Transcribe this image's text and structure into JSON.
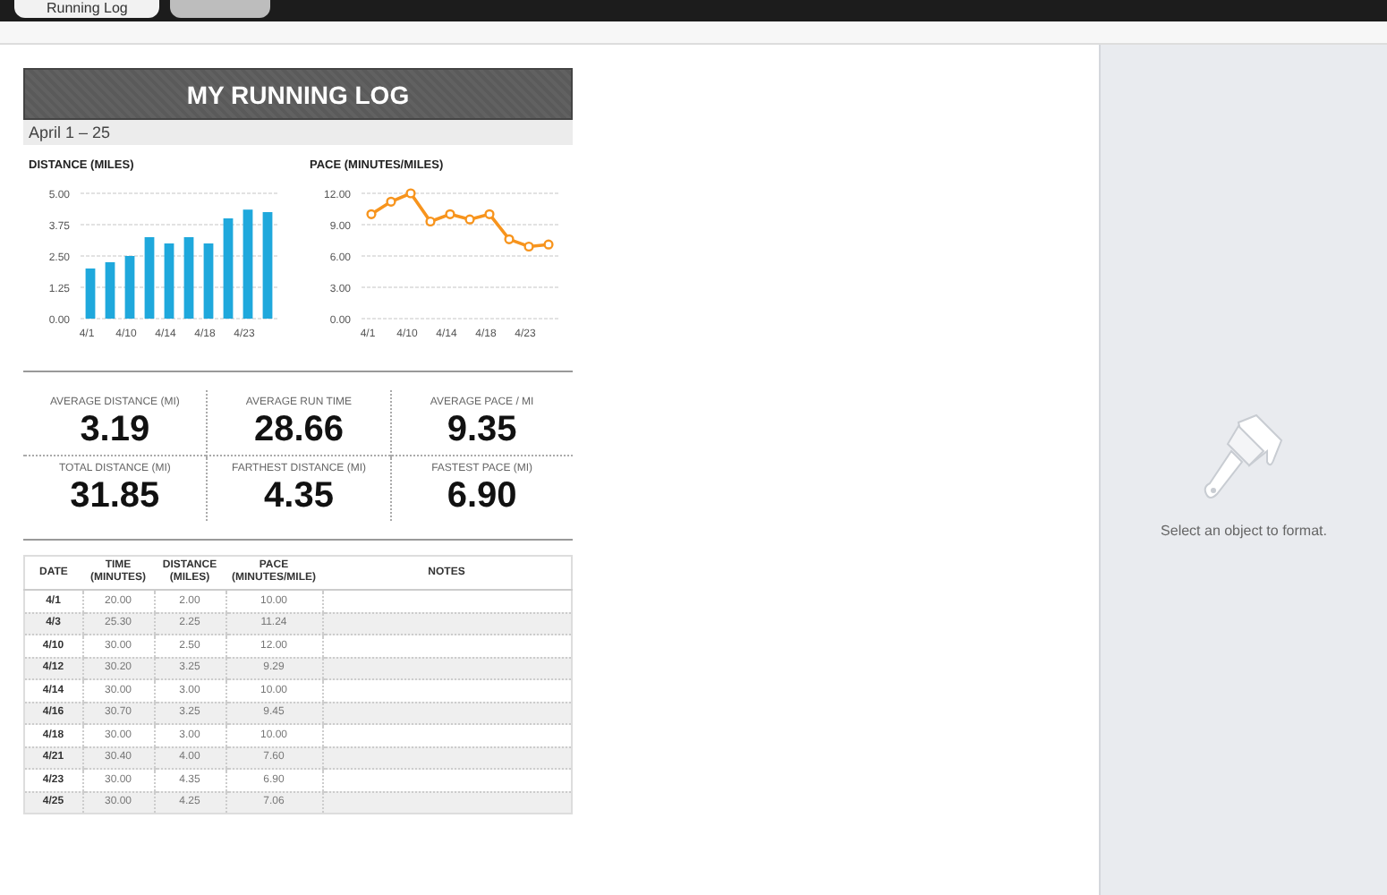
{
  "tabs": [
    {
      "label": "Running Log",
      "selected": true
    },
    {
      "selected": false
    }
  ],
  "title": "MY RUNNING LOG",
  "date_range": "April 1 – 25",
  "distance_chart": {
    "title": "DISTANCE (MILES)",
    "chart_data": {
      "type": "bar",
      "grid": true,
      "categories": [
        "4/1",
        null,
        "4/10",
        null,
        "4/14",
        null,
        "4/18",
        null,
        "4/23",
        null
      ],
      "series": [
        {
          "color": "#1fa8dc",
          "values": [
            2.0,
            2.25,
            2.5,
            3.25,
            3.0,
            3.25,
            3.0,
            4.0,
            4.35,
            4.25
          ]
        }
      ],
      "ylim": [
        0,
        5
      ],
      "yticks": [
        {
          "value": 0,
          "label": "0.00"
        },
        {
          "value": 1.25,
          "label": "1.25"
        },
        {
          "value": 2.5,
          "label": "2.50"
        },
        {
          "value": 3.75,
          "label": "3.75"
        },
        {
          "value": 5,
          "label": "5.00"
        }
      ]
    }
  },
  "pace_chart": {
    "title": "PACE (MINUTES/MILES)",
    "chart_data": {
      "type": "line",
      "grid": true,
      "categories": [
        "4/1",
        null,
        "4/10",
        null,
        "4/14",
        null,
        "4/18",
        null,
        "4/23",
        null
      ],
      "series": [
        {
          "color": "#f7941d",
          "marker": "circle",
          "values": [
            10.0,
            11.2,
            12.0,
            9.3,
            10.0,
            9.5,
            10.0,
            7.6,
            6.9,
            7.1
          ]
        }
      ],
      "ylim": [
        0,
        12
      ],
      "yticks": [
        {
          "value": 0,
          "label": "0.00"
        },
        {
          "value": 3,
          "label": "3.00"
        },
        {
          "value": 6,
          "label": "6.00"
        },
        {
          "value": 9,
          "label": "9.00"
        },
        {
          "value": 12,
          "label": "12.00"
        }
      ]
    }
  },
  "stats": [
    {
      "label": "AVERAGE DISTANCE (MI)",
      "value": "3.19"
    },
    {
      "label": "AVERAGE RUN TIME",
      "value": "28.66"
    },
    {
      "label": "AVERAGE PACE / MI",
      "value": "9.35"
    },
    {
      "label": "TOTAL DISTANCE (MI)",
      "value": "31.85"
    },
    {
      "label": "FARTHEST DISTANCE (MI)",
      "value": "4.35"
    },
    {
      "label": "FASTEST PACE (MI)",
      "value": "6.90"
    }
  ],
  "table": {
    "columns": [
      "DATE",
      "TIME (MINUTES)",
      "DISTANCE (MILES)",
      "PACE (MINUTES/MILE)",
      "NOTES"
    ],
    "rows": [
      [
        "4/1",
        "20.00",
        "2.00",
        "10.00"
      ],
      [
        "4/3",
        "25.30",
        "2.25",
        "11.24"
      ],
      [
        "4/10",
        "30.00",
        "2.50",
        "12.00"
      ],
      [
        "4/12",
        "30.20",
        "3.25",
        "9.29"
      ],
      [
        "4/14",
        "30.00",
        "3.00",
        "10.00"
      ],
      [
        "4/16",
        "30.70",
        "3.25",
        "9.45"
      ],
      [
        "4/18",
        "30.00",
        "3.00",
        "10.00"
      ],
      [
        "4/21",
        "30.40",
        "4.00",
        "7.60"
      ],
      [
        "4/23",
        "30.00",
        "4.35",
        "6.90"
      ],
      [
        "4/25",
        "30.00",
        "4.25",
        "7.06"
      ]
    ]
  },
  "format_panel": {
    "message": "Select an object to format."
  }
}
